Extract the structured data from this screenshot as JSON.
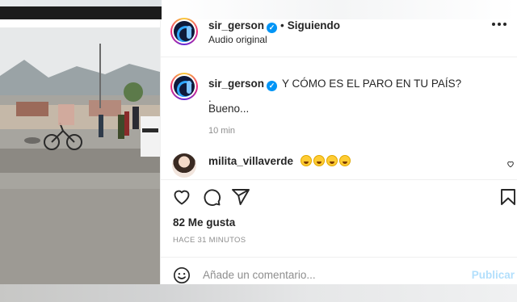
{
  "post": {
    "author": "sir_gerson",
    "follow_status": "Siguiendo",
    "audio": "Audio original",
    "caption": {
      "author": "sir_gerson",
      "line1": "Y CÓMO ES EL PARO EN TU PAÍS?",
      "line2": ".",
      "line3": "Bueno...",
      "time": "10 min"
    },
    "comment": {
      "author": "milita_villaverde",
      "emoji_count": 4
    },
    "likes": "82 Me gusta",
    "time_ago": "HACE 31 MINUTOS"
  },
  "add_comment": {
    "placeholder": "Añade un comentario...",
    "post_label": "Publicar"
  },
  "colors": {
    "verified": "#0095f6",
    "muted": "#8e8e8e",
    "post_disabled": "#b2dffc"
  },
  "icons": [
    "more-icon",
    "verified-icon",
    "heart-icon",
    "comment-icon",
    "share-icon",
    "bookmark-icon",
    "smiley-icon"
  ]
}
